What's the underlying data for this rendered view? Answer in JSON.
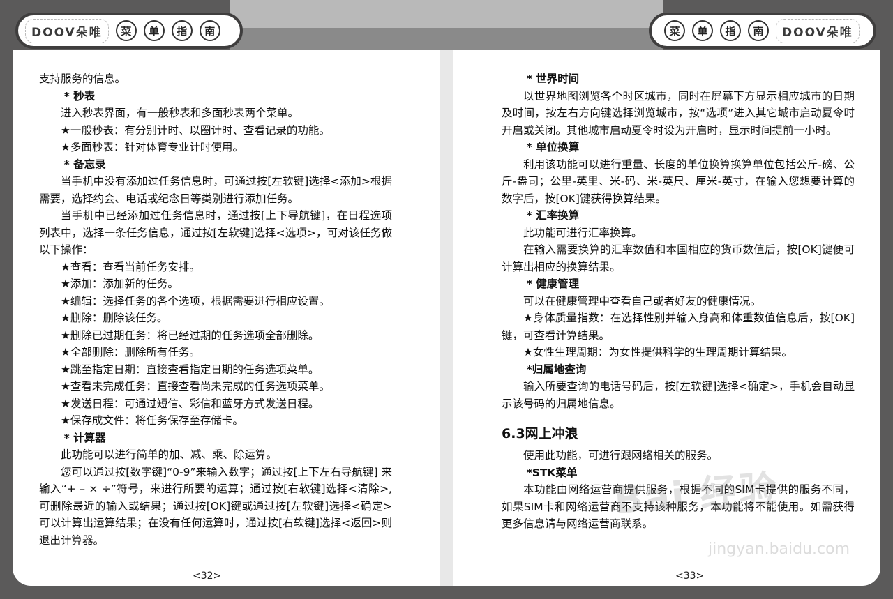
{
  "header_left": {
    "logo": "DOOV朵唯",
    "chars": [
      "菜",
      "单",
      "指",
      "南"
    ]
  },
  "header_right": {
    "chars": [
      "菜",
      "单",
      "指",
      "南"
    ],
    "logo": "DOOV朵唯"
  },
  "left": {
    "p1": "支持服务的信息。",
    "h_stopwatch": "* 秒表",
    "p2": "进入秒表界面，有一般秒表和多面秒表两个菜单。",
    "p3": "★一般秒表：有分别计时、以圈计时、查看记录的功能。",
    "p4": "★多面秒表：针对体育专业计时使用。",
    "h_memo": "* 备忘录",
    "p5": "当手机中没有添加过任务信息时，可通过按[左软键]选择<添加>根据需要，选择约会、电话或纪念日等类别进行添加任务。",
    "p6": "当手机中已经添加过任务信息时，通过按[上下导航键]，在日程选项列表中，选择一条任务信息，通过按[左软键]选择<选项>，可对该任务做以下操作：",
    "items": [
      "★查看：查看当前任务安排。",
      "★添加：添加新的任务。",
      "★编辑：选择任务的各个选项，根据需要进行相应设置。",
      "★删除：删除该任务。",
      "★删除已过期任务：将已经过期的任务选项全部删除。",
      "★全部删除：删除所有任务。",
      "★跳至指定日期：直接查看指定日期的任务选项菜单。",
      "★查看未完成任务：直接查看尚未完成的任务选项菜单。",
      "★发送日程：可通过短信、彩信和蓝牙方式发送日程。",
      "★保存成文件：将任务保存至存储卡。"
    ],
    "h_calc": "* 计算器",
    "p7": "此功能可以进行简单的加、减、乘、除运算。",
    "p8": "您可以通过按[数字键]“0-9”来输入数字；通过按[上下左右导航键] 来输入“+ – × ÷”符号，来进行所要的运算；通过按[右软键]选择<清除>,可删除最近的输入或结果；通过按[OK]键或通过按[左软键]选择<确定>可以计算出运算结果；在没有任何运算时，通过按[右软键]选择<返回>则退出计算器。",
    "page_num": "<32>"
  },
  "right": {
    "h_world": "* 世界时间",
    "p1": "以世界地图浏览各个时区城市，同时在屏幕下方显示相应城市的日期及时间，按左右方向键选择浏览城市，按“选项”进入其它城市启动夏令时开启或关闭。其他城市启动夏令时设为开启时，显示时间提前一小时。",
    "h_unit": "* 单位换算",
    "p2": "利用该功能可以进行重量、长度的单位换算换算单位包括公斤-磅、公斤-盎司；公里-英里、米-码、米-英尺、厘米-英寸，在输入您想要计算的数字后，按[OK]键获得换算结果。",
    "h_rate": "* 汇率换算",
    "p3": "此功能可进行汇率换算。",
    "p4": "在输入需要换算的汇率数值和本国相应的货币数值后，按[OK]键便可计算出相应的换算结果。",
    "h_health": "* 健康管理",
    "p5": "可以在健康管理中查看自己或者好友的健康情况。",
    "p6": "★身体质量指数：在选择性别并输入身高和体重数值信息后，按[OK]键，可查看计算结果。",
    "p7": "★女性生理周期：为女性提供科学的生理周期计算结果。",
    "h_loc": "*归属地查询",
    "p8": "输入所要查询的电话号码后，按[左软键]选择<确定>，手机会自动显示该号码的归属地信息。",
    "section": "6.3网上冲浪",
    "p9": "使用此功能，可进行跟网络相关的服务。",
    "h_stk": "*STK菜单",
    "p10": "本功能由网络运营商提供服务，根据不同的SIM卡提供的服务不同，如果SIM卡和网络运营商不支持该种服务，本功能将不能使用。如需获得更多信息请与网络运营商联系。",
    "page_num": "<33>"
  },
  "watermark": {
    "main": "Bai 经验",
    "sub": "jingyan.baidu.com"
  }
}
